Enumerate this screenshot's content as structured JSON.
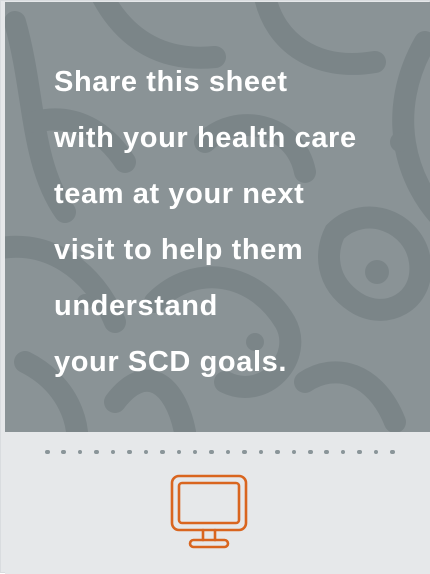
{
  "card": {
    "headline_lines": [
      "Share this sheet",
      "with your health care",
      "team at your next",
      "visit to help them",
      "understand",
      "your SCD goals."
    ],
    "icon": "desktop-monitor-icon"
  },
  "colors": {
    "hero_background": "#8a9396",
    "pattern_stroke": "#7b8588",
    "headline_text": "#ffffff",
    "footer_background": "#e6e8ea",
    "divider_dots": "#8a9599",
    "icon_accent": "#d9651f"
  }
}
